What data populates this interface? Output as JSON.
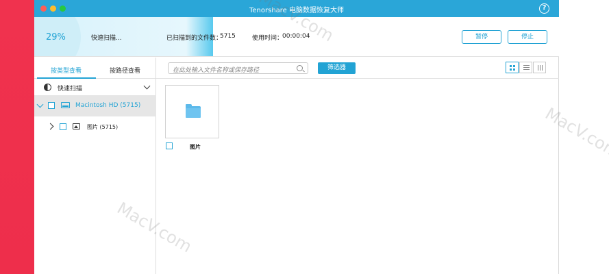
{
  "window": {
    "title": "Tenorshare 电脑数据恢复大师",
    "help_icon": "?"
  },
  "progress": {
    "percent_label": "29%",
    "percent": 0.29,
    "status": "快速扫描...",
    "files_label": "已扫描到的文件数：",
    "files_count": "5715",
    "time_label": "使用时间：",
    "time_value": "00:00:04",
    "pause_label": "暂停",
    "stop_label": "停止"
  },
  "sidebar": {
    "tabs": [
      {
        "label": "按类型查看",
        "active": true
      },
      {
        "label": "按路径查看",
        "active": false
      }
    ],
    "quick_scan": "快速扫描",
    "drive": "Macintosh HD (5715)",
    "pictures": "图片 (5715)"
  },
  "toolbar": {
    "search_placeholder": "在此处输入文件名称或保存路径",
    "filter_label": "筛选器"
  },
  "content": {
    "items": [
      {
        "label": "图片",
        "icon": "folder-icon"
      }
    ]
  },
  "watermarks": [
    "MacV.com",
    "MacV.com",
    "MacV.com"
  ],
  "colors": {
    "accent": "#22a3d4",
    "titlebar": "#2aa6d8",
    "background_left": "#f0324e"
  }
}
